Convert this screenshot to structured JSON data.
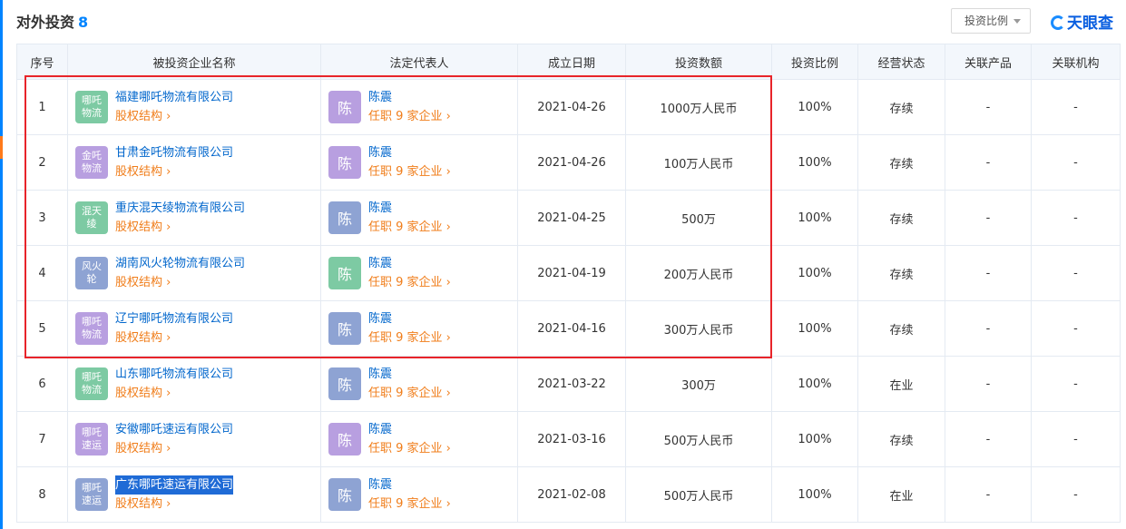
{
  "header": {
    "title": "对外投资",
    "count": "8",
    "dropdown_label": "投资比例",
    "logo_text": "天眼查"
  },
  "columns": [
    "序号",
    "被投资企业名称",
    "法定代表人",
    "成立日期",
    "投资数额",
    "投资比例",
    "经营状态",
    "关联产品",
    "关联机构"
  ],
  "rows": [
    {
      "idx": "1",
      "badge": "哪吒物流",
      "badge_color": "#7dcaa3",
      "company": "福建哪吒物流有限公司",
      "sub": "股权结构 ›",
      "avatar": "陈",
      "avatar_color": "#b89fe0",
      "rep": "陈震",
      "rep_sub": "任职 9 家企业 ›",
      "date": "2021-04-26",
      "amount": "1000万人民币",
      "ratio": "100%",
      "status": "存续",
      "product": "-",
      "org": "-"
    },
    {
      "idx": "2",
      "badge": "金吒物流",
      "badge_color": "#b89fe0",
      "company": "甘肃金吒物流有限公司",
      "sub": "股权结构 ›",
      "avatar": "陈",
      "avatar_color": "#b89fe0",
      "rep": "陈震",
      "rep_sub": "任职 9 家企业 ›",
      "date": "2021-04-26",
      "amount": "100万人民币",
      "ratio": "100%",
      "status": "存续",
      "product": "-",
      "org": "-"
    },
    {
      "idx": "3",
      "badge": "混天绫",
      "badge_color": "#7dcaa3",
      "company": "重庆混天绫物流有限公司",
      "sub": "股权结构 ›",
      "avatar": "陈",
      "avatar_color": "#8ea3d3",
      "rep": "陈震",
      "rep_sub": "任职 9 家企业 ›",
      "date": "2021-04-25",
      "amount": "500万",
      "ratio": "100%",
      "status": "存续",
      "product": "-",
      "org": "-"
    },
    {
      "idx": "4",
      "badge": "风火轮",
      "badge_color": "#8ea3d3",
      "company": "湖南风火轮物流有限公司",
      "sub": "股权结构 ›",
      "avatar": "陈",
      "avatar_color": "#7dcaa3",
      "rep": "陈震",
      "rep_sub": "任职 9 家企业 ›",
      "date": "2021-04-19",
      "amount": "200万人民币",
      "ratio": "100%",
      "status": "存续",
      "product": "-",
      "org": "-"
    },
    {
      "idx": "5",
      "badge": "哪吒物流",
      "badge_color": "#b89fe0",
      "company": "辽宁哪吒物流有限公司",
      "sub": "股权结构 ›",
      "avatar": "陈",
      "avatar_color": "#8ea3d3",
      "rep": "陈震",
      "rep_sub": "任职 9 家企业 ›",
      "date": "2021-04-16",
      "amount": "300万人民币",
      "ratio": "100%",
      "status": "存续",
      "product": "-",
      "org": "-"
    },
    {
      "idx": "6",
      "badge": "哪吒物流",
      "badge_color": "#7dcaa3",
      "company": "山东哪吒物流有限公司",
      "sub": "股权结构 ›",
      "avatar": "陈",
      "avatar_color": "#8ea3d3",
      "rep": "陈震",
      "rep_sub": "任职 9 家企业 ›",
      "date": "2021-03-22",
      "amount": "300万",
      "ratio": "100%",
      "status": "在业",
      "product": "-",
      "org": "-"
    },
    {
      "idx": "7",
      "badge": "哪吒速运",
      "badge_color": "#b89fe0",
      "company": "安徽哪吒速运有限公司",
      "sub": "股权结构 ›",
      "avatar": "陈",
      "avatar_color": "#b89fe0",
      "rep": "陈震",
      "rep_sub": "任职 9 家企业 ›",
      "date": "2021-03-16",
      "amount": "500万人民币",
      "ratio": "100%",
      "status": "存续",
      "product": "-",
      "org": "-"
    },
    {
      "idx": "8",
      "badge": "哪吒速运",
      "badge_color": "#8ea3d3",
      "company": "广东哪吒速运有限公司",
      "sub": "股权结构 ›",
      "avatar": "陈",
      "avatar_color": "#8ea3d3",
      "rep": "陈震",
      "rep_sub": "任职 9 家企业 ›",
      "date": "2021-02-08",
      "amount": "500万人民币",
      "ratio": "100%",
      "status": "在业",
      "product": "-",
      "org": "-",
      "selected": true
    }
  ]
}
